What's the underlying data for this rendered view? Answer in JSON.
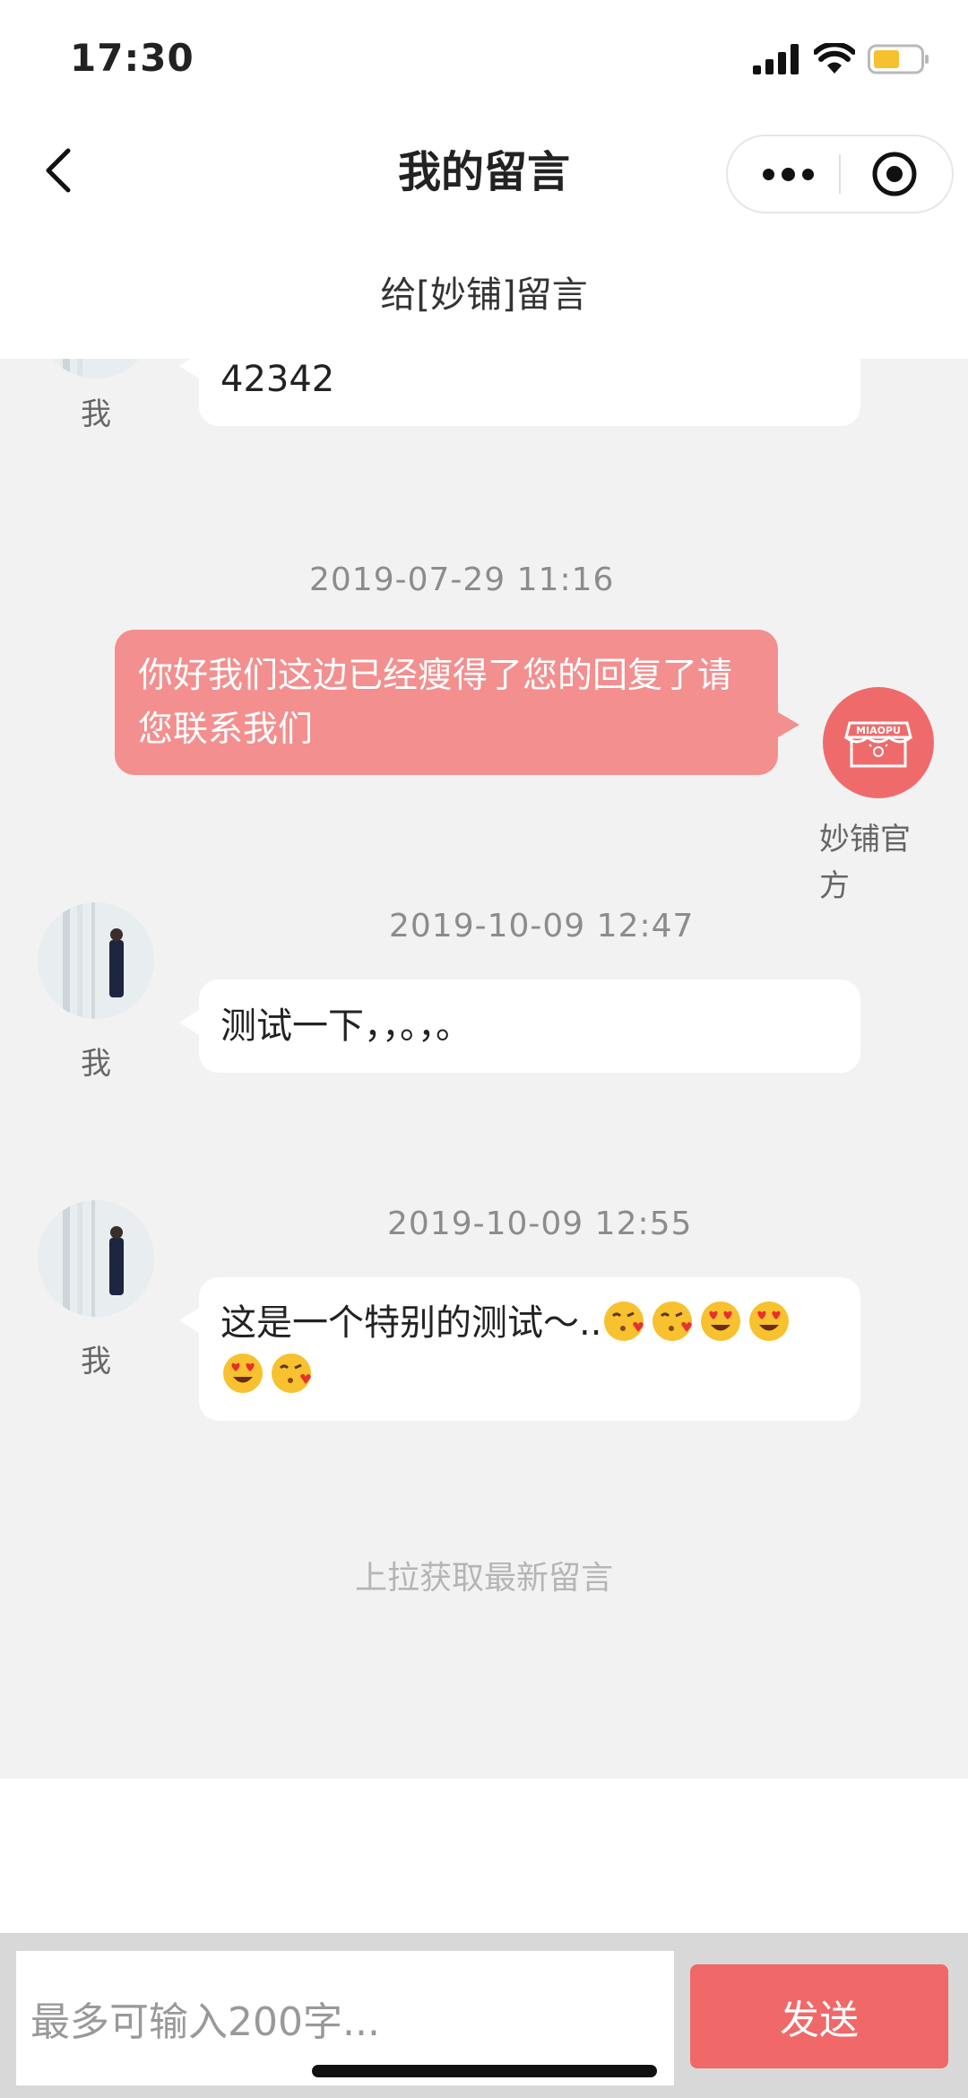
{
  "status_bar": {
    "time": "17:30"
  },
  "nav": {
    "title": "我的留言"
  },
  "subheader": {
    "text": "给[妙铺]留言"
  },
  "messages": [
    {
      "sender": "我",
      "text": "42342"
    },
    {
      "timestamp": "2019-07-29 11:16",
      "sender": "妙铺官方",
      "text": "你好我们这边已经瘦得了您的回复了请您联系我们",
      "logo_text": "MIAOPU"
    },
    {
      "timestamp": "2019-10-09 12:47",
      "sender": "我",
      "text": "测试一下，，。，。"
    },
    {
      "timestamp": "2019-10-09 12:55",
      "sender": "我",
      "text": "这是一个特别的测试～..",
      "emojis": [
        "kissing-heart",
        "kissing-heart",
        "heart-eyes",
        "heart-eyes",
        "heart-eyes",
        "kissing-heart"
      ]
    }
  ],
  "load_hint": "上拉获取最新留言",
  "input": {
    "placeholder": "最多可输入200字..."
  },
  "send_label": "发送",
  "colors": {
    "accent": "#f06868",
    "official_bubble": "#f38f8f",
    "chat_bg": "#f2f2f2"
  }
}
